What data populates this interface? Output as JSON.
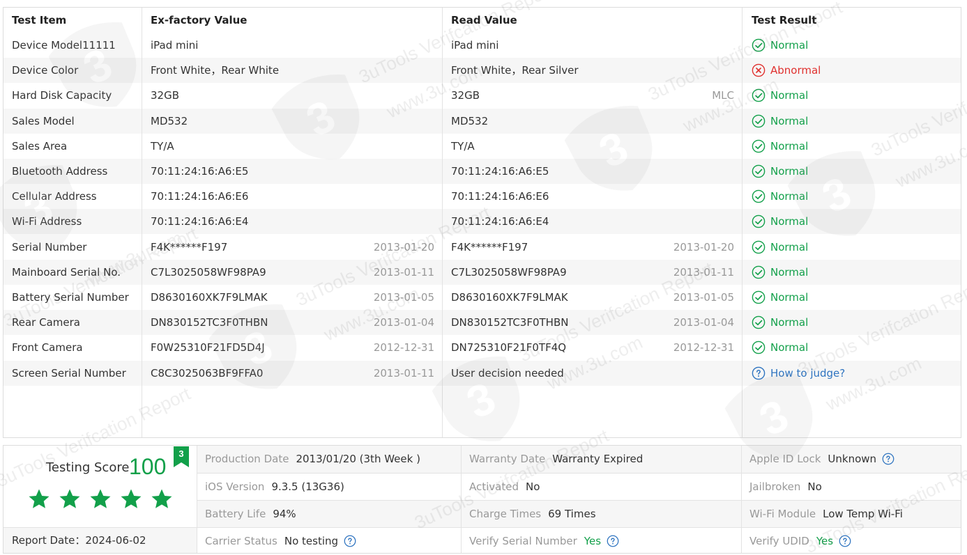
{
  "headers": {
    "item": "Test Item",
    "factory": "Ex-factory Value",
    "read": "Read Value",
    "result": "Test Result"
  },
  "rows": [
    {
      "item": "Device Model11111",
      "factory": "iPad mini",
      "factory_date": "",
      "read": "iPad mini",
      "read_date": "",
      "result": "Normal",
      "status": "normal"
    },
    {
      "item": "Device Color",
      "factory": "Front White，Rear White",
      "factory_date": "",
      "read": "Front White，Rear Silver",
      "read_date": "",
      "result": "Abnormal",
      "status": "abnormal"
    },
    {
      "item": "Hard Disk Capacity",
      "factory": "32GB",
      "factory_date": "",
      "read": "32GB",
      "read_date": "MLC",
      "result": "Normal",
      "status": "normal"
    },
    {
      "item": "Sales Model",
      "factory": "MD532",
      "factory_date": "",
      "read": "MD532",
      "read_date": "",
      "result": "Normal",
      "status": "normal"
    },
    {
      "item": "Sales Area",
      "factory": "TY/A",
      "factory_date": "",
      "read": "TY/A",
      "read_date": "",
      "result": "Normal",
      "status": "normal"
    },
    {
      "item": "Bluetooth Address",
      "factory": "70:11:24:16:A6:E5",
      "factory_date": "",
      "read": "70:11:24:16:A6:E5",
      "read_date": "",
      "result": "Normal",
      "status": "normal"
    },
    {
      "item": "Cellular Address",
      "factory": "70:11:24:16:A6:E6",
      "factory_date": "",
      "read": "70:11:24:16:A6:E6",
      "read_date": "",
      "result": "Normal",
      "status": "normal"
    },
    {
      "item": "Wi-Fi Address",
      "factory": "70:11:24:16:A6:E4",
      "factory_date": "",
      "read": "70:11:24:16:A6:E4",
      "read_date": "",
      "result": "Normal",
      "status": "normal"
    },
    {
      "item": "Serial Number",
      "factory": "F4K******F197",
      "factory_date": "2013-01-20",
      "read": "F4K******F197",
      "read_date": "2013-01-20",
      "result": "Normal",
      "status": "normal"
    },
    {
      "item": "Mainboard Serial No.",
      "factory": "C7L3025058WF98PA9",
      "factory_date": "2013-01-11",
      "read": "C7L3025058WF98PA9",
      "read_date": "2013-01-11",
      "result": "Normal",
      "status": "normal"
    },
    {
      "item": "Battery Serial Number",
      "factory": "D8630160XK7F9LMAK",
      "factory_date": "2013-01-05",
      "read": "D8630160XK7F9LMAK",
      "read_date": "2013-01-05",
      "result": "Normal",
      "status": "normal"
    },
    {
      "item": "Rear Camera",
      "factory": "DN830152TC3F0THBN",
      "factory_date": "2013-01-04",
      "read": "DN830152TC3F0THBN",
      "read_date": "2013-01-04",
      "result": "Normal",
      "status": "normal"
    },
    {
      "item": "Front Camera",
      "factory": "F0W25310F21FD5D4J",
      "factory_date": "2012-12-31",
      "read": "DN725310F21F0TF4Q",
      "read_date": "2012-12-31",
      "result": "Normal",
      "status": "normal"
    },
    {
      "item": "Screen Serial Number",
      "factory": "C8C3025063BF9FFA0",
      "factory_date": "2013-01-11",
      "read": "User decision needed",
      "read_date": "",
      "result": "How to judge?",
      "status": "judge"
    }
  ],
  "score": {
    "label": "Testing Score",
    "value": "100",
    "badge": "3",
    "stars": 5
  },
  "report_date": "Report Date：2024-06-02",
  "info": [
    [
      {
        "label": "Production Date",
        "value": "2013/01/20 (3th Week )",
        "style": "",
        "help": false
      },
      {
        "label": "Warranty Date",
        "value": "Warranty Expired",
        "style": "",
        "help": false
      },
      {
        "label": "Apple ID Lock",
        "value": "Unknown",
        "style": "",
        "help": true
      }
    ],
    [
      {
        "label": "iOS Version",
        "value": "9.3.5 (13G36)",
        "style": "",
        "help": false
      },
      {
        "label": "Activated",
        "value": "No",
        "style": "",
        "help": false
      },
      {
        "label": "Jailbroken",
        "value": "No",
        "style": "",
        "help": false
      }
    ],
    [
      {
        "label": "Battery Life",
        "value": "94%",
        "style": "",
        "help": false
      },
      {
        "label": "Charge Times",
        "value": "69 Times",
        "style": "",
        "help": false
      },
      {
        "label": "Wi-Fi Module",
        "value": "Low Temp Wi-Fi",
        "style": "",
        "help": false
      }
    ],
    [
      {
        "label": "Carrier Status",
        "value": "No testing",
        "style": "",
        "help": true
      },
      {
        "label": "Verify Serial Number",
        "value": "Yes",
        "style": "green",
        "help": true
      },
      {
        "label": "Verify UDID",
        "value": "Yes",
        "style": "green",
        "help": true
      }
    ]
  ],
  "watermark": {
    "brand": "3uTools Verifcation Report",
    "site": "www.3u.com"
  },
  "colors": {
    "normal": "#12a04a",
    "abnormal": "#e0312f",
    "judge": "#2f74c0",
    "label": "#999999",
    "alt_row": "#f6f6f6"
  },
  "icons": {
    "normal": "check-circle-icon",
    "abnormal": "x-circle-icon",
    "judge": "question-circle-icon",
    "star": "star-icon",
    "badge": "ribbon-badge-icon"
  }
}
